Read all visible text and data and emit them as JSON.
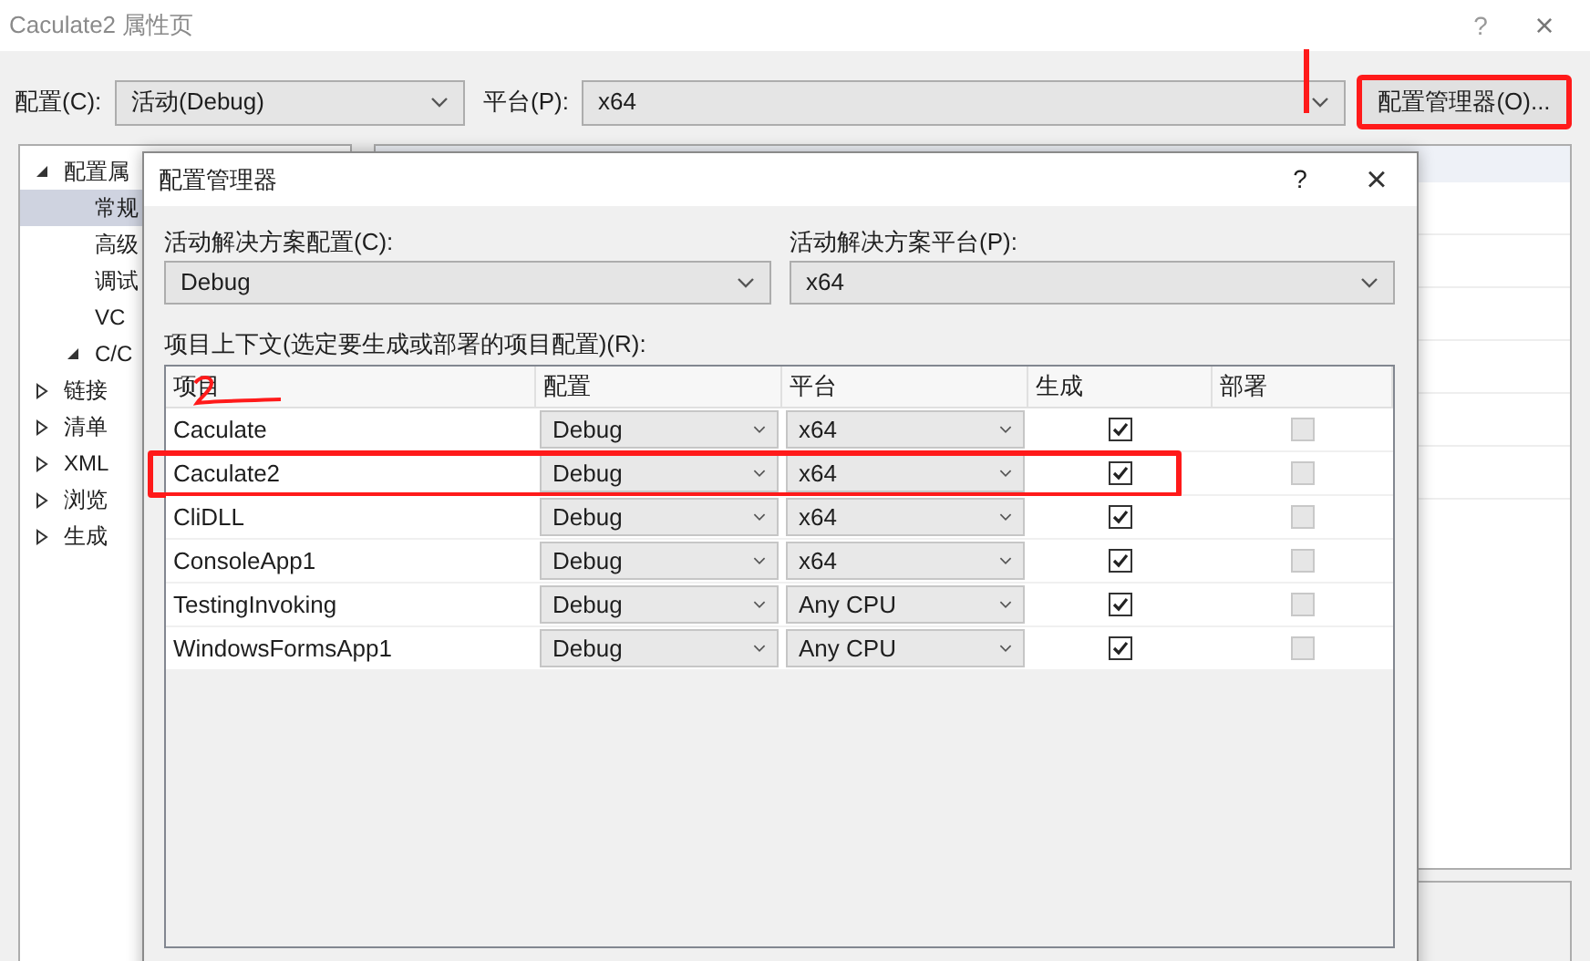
{
  "window": {
    "title": "Caculate2 属性页",
    "help": "?",
    "close": "×"
  },
  "toolbar": {
    "config_label": "配置(C):",
    "config_value": "活动(Debug)",
    "platform_label": "平台(P):",
    "platform_value": "x64",
    "manager_button": "配置管理器(O)..."
  },
  "tree": [
    {
      "label": "配置属",
      "expanded": true,
      "selected": false,
      "children": [
        {
          "label": "常规",
          "selected": true
        },
        {
          "label": "高级",
          "selected": false
        },
        {
          "label": "调试",
          "selected": false
        },
        {
          "label": "VC",
          "selected": false
        },
        {
          "label": "C/C",
          "selected": false,
          "expanded": true
        }
      ]
    },
    {
      "label": "链接",
      "expanded": false,
      "selected": false
    },
    {
      "label": "清单",
      "expanded": false,
      "selected": false
    },
    {
      "label": "XML",
      "expanded": false,
      "selected": false
    },
    {
      "label": "浏览",
      "expanded": false,
      "selected": false
    },
    {
      "label": "生成",
      "expanded": false,
      "selected": false
    }
  ],
  "dialog": {
    "title": "配置管理器",
    "help": "?",
    "close": "×",
    "solution_config_label": "活动解决方案配置(C):",
    "solution_config_value": "Debug",
    "solution_platform_label": "活动解决方案平台(P):",
    "solution_platform_value": "x64",
    "context_label": "项目上下文(选定要生成或部署的项目配置)(R):",
    "table": {
      "columns": [
        "项目",
        "配置",
        "平台",
        "生成",
        "部署"
      ],
      "rows": [
        {
          "project": "Caculate",
          "config": "Debug",
          "platform": "x64",
          "build": true,
          "deploy": false,
          "deploy_disabled": true,
          "highlighted": false
        },
        {
          "project": "Caculate2",
          "config": "Debug",
          "platform": "x64",
          "build": true,
          "deploy": false,
          "deploy_disabled": true,
          "highlighted": true
        },
        {
          "project": "CliDLL",
          "config": "Debug",
          "platform": "x64",
          "build": true,
          "deploy": false,
          "deploy_disabled": true,
          "highlighted": false
        },
        {
          "project": "ConsoleApp1",
          "config": "Debug",
          "platform": "x64",
          "build": true,
          "deploy": false,
          "deploy_disabled": true,
          "highlighted": false
        },
        {
          "project": "TestingInvoking",
          "config": "Debug",
          "platform": "Any CPU",
          "build": true,
          "deploy": false,
          "deploy_disabled": true,
          "highlighted": false
        },
        {
          "project": "WindowsFormsApp1",
          "config": "Debug",
          "platform": "Any CPU",
          "build": true,
          "deploy": false,
          "deploy_disabled": true,
          "highlighted": false
        }
      ]
    }
  },
  "annotations": {
    "manager_button_highlighted": true,
    "marker_line": true,
    "handwritten_two": true
  }
}
